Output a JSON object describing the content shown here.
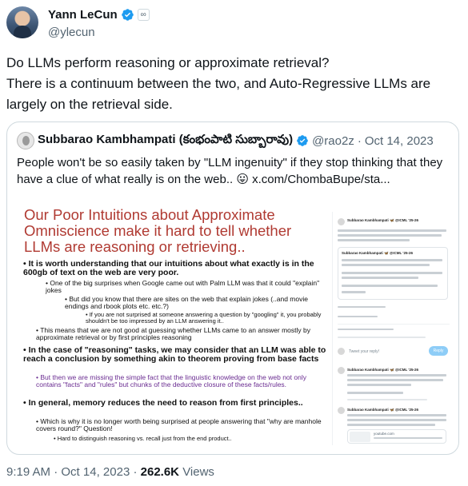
{
  "author": {
    "name": "Yann LeCun",
    "handle": "@ylecun",
    "affiliation_icon": "infinity-affiliation-badge",
    "verified_icon": "verified-badge",
    "colors": {
      "verified": "#1d9bf0"
    }
  },
  "tweet": {
    "text": "Do LLMs perform reasoning or approximate retrieval?\nThere is a continuum between the two, and Auto-Regressive LLMs are largely on the retrieval side."
  },
  "quote": {
    "name": "Subbarao Kambhampati (కంభంపాటి సుబ్బారావు)",
    "handle": "@rao2z",
    "separator": "·",
    "date": "Oct 14, 2023",
    "text": "People won't be so easily taken by \"LLM ingenuity\" if they stop thinking that they have a clue of what really is on the web.. 😛 ",
    "link": "x.com/ChombaBupe/sta...",
    "slide": {
      "title": "Our Poor Intuitions about Approximate Omniscience make it hard to tell whether LLMs are reasoning or retrieving..",
      "b1": "It is worth understanding that our intuitions about what exactly is in the 600gb of text on the web are very poor.",
      "b1a": "One of the big surprises when Google came out with Palm LLM was that it could \"explain\" jokes",
      "b1a1": "But did you know that there are sites on the web that explain jokes (..and movie endings and rbook plots etc. etc.?)",
      "b1a1a": "If you are not surprised at someone answering a question by \"googling\" it, you probably shouldn't be too impressed by an LLM answering it..",
      "b1b": "This means that we are not good at guessing whether LLMs came to an answer mostly by approximate retrieval or by first principles reasoning",
      "b2": "In the case of \"reasoning\" tasks, we may consider that an LLM was able to reach a conclusion by something akin to theorem proving from base facts",
      "b2a": "But then we are missing the simple fact that the linguistic knowledge on the web not only contains \"facts\" and \"rules\" but chunks of the deductive closure of these facts/rules.",
      "b3": "In general, memory reduces the need to reason from first principles..",
      "b3a": "Which is why it is no longer worth being surprised at people answering that \"why are manhole covers round?\" Question!",
      "b3a1": "Hard to distinguish reasoning vs. recall just from the end product..",
      "colors": {
        "title": "#b03a32",
        "highlight": "#6a2c91"
      }
    },
    "panel": {
      "name1": "Subbarao Kambhampati 🦋 @ICML '25-26",
      "name2": "Subbarao Kambhampati 🦋 @ICML '25-26",
      "name3": "Subbarao Kambhampati 🦋 @ICML '25-26",
      "name4": "Subbarao Kambhampati 🦋 @ICML '25-26",
      "reply_placeholder": "Tweet your reply!",
      "reply_button": "Reply",
      "link_card": "youtube.com"
    }
  },
  "meta": {
    "time": "9:19 AM",
    "separator": "·",
    "date": "Oct 14, 2023",
    "separator2": "·",
    "views_count": "262.6K",
    "views_label": "Views"
  }
}
